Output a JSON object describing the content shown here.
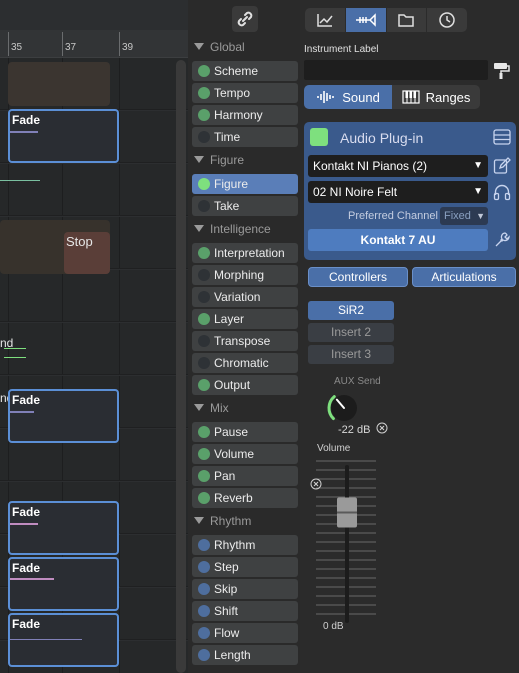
{
  "timeline": {
    "ruler": [
      "35",
      "37",
      "39"
    ],
    "clips": [
      {
        "title": "Fade"
      },
      {
        "title": "Fade"
      },
      {
        "title": "Fade"
      },
      {
        "title": "Fade"
      },
      {
        "title": "Fade"
      }
    ],
    "stop_label": "Stop",
    "edge_label_1": "nd",
    "edge_label_2": "nd",
    "accent": "#5b8fd6"
  },
  "modules": {
    "sections": [
      {
        "title": "Global",
        "items": [
          {
            "label": "Scheme",
            "color": "#5aa06a"
          },
          {
            "label": "Tempo",
            "color": "#5aa06a"
          },
          {
            "label": "Harmony",
            "color": "#5aa06a"
          },
          {
            "label": "Time",
            "color": "#2e3236"
          }
        ]
      },
      {
        "title": "Figure",
        "items": [
          {
            "label": "Figure",
            "color": "#7ee07e",
            "selected": true
          },
          {
            "label": "Take",
            "color": "#2e3236"
          }
        ]
      },
      {
        "title": "Intelligence",
        "items": [
          {
            "label": "Interpretation",
            "color": "#5aa06a"
          },
          {
            "label": "Morphing",
            "color": "#2e3236"
          },
          {
            "label": "Variation",
            "color": "#2e3236"
          },
          {
            "label": "Layer",
            "color": "#5aa06a"
          },
          {
            "label": "Transpose",
            "color": "#2e3236"
          },
          {
            "label": "Chromatic",
            "color": "#2e3236"
          },
          {
            "label": "Output",
            "color": "#5aa06a"
          }
        ]
      },
      {
        "title": "Mix",
        "items": [
          {
            "label": "Pause",
            "color": "#5aa06a"
          },
          {
            "label": "Volume",
            "color": "#5aa06a"
          },
          {
            "label": "Pan",
            "color": "#5aa06a"
          },
          {
            "label": "Reverb",
            "color": "#5aa06a"
          }
        ]
      },
      {
        "title": "Rhythm",
        "items": [
          {
            "label": "Rhythm",
            "color": "#4e6e9e"
          },
          {
            "label": "Step",
            "color": "#4e6e9e"
          },
          {
            "label": "Skip",
            "color": "#4e6e9e"
          },
          {
            "label": "Shift",
            "color": "#4e6e9e"
          },
          {
            "label": "Flow",
            "color": "#4e6e9e"
          },
          {
            "label": "Length",
            "color": "#4e6e9e"
          }
        ]
      }
    ]
  },
  "inspector": {
    "top_tabs": [
      "chart-icon",
      "trumpet-icon",
      "folder-icon",
      "clock-icon"
    ],
    "instrument_label": "Instrument Label",
    "instrument_value": "",
    "sound_label": "Sound",
    "ranges_label": "Ranges",
    "plugin_title": "Audio Plug-in",
    "instrument_select": "Kontakt NI Pianos (2)",
    "preset_select": "02 NI Noire Felt",
    "channel_label": "Preferred Channel",
    "channel_value": "Fixed",
    "plugin_name": "Kontakt 7 AU",
    "controllers_label": "Controllers",
    "articulations_label": "Articulations",
    "inserts": [
      "SiR2",
      "Insert 2",
      "Insert 3"
    ],
    "aux_label": "AUX Send",
    "aux_value": "-22 dB",
    "aux_level": 0.35,
    "volume_label": "Volume",
    "volume_value": "0 dB",
    "volume_level": 0.75,
    "accent": "#4a6fa8"
  }
}
